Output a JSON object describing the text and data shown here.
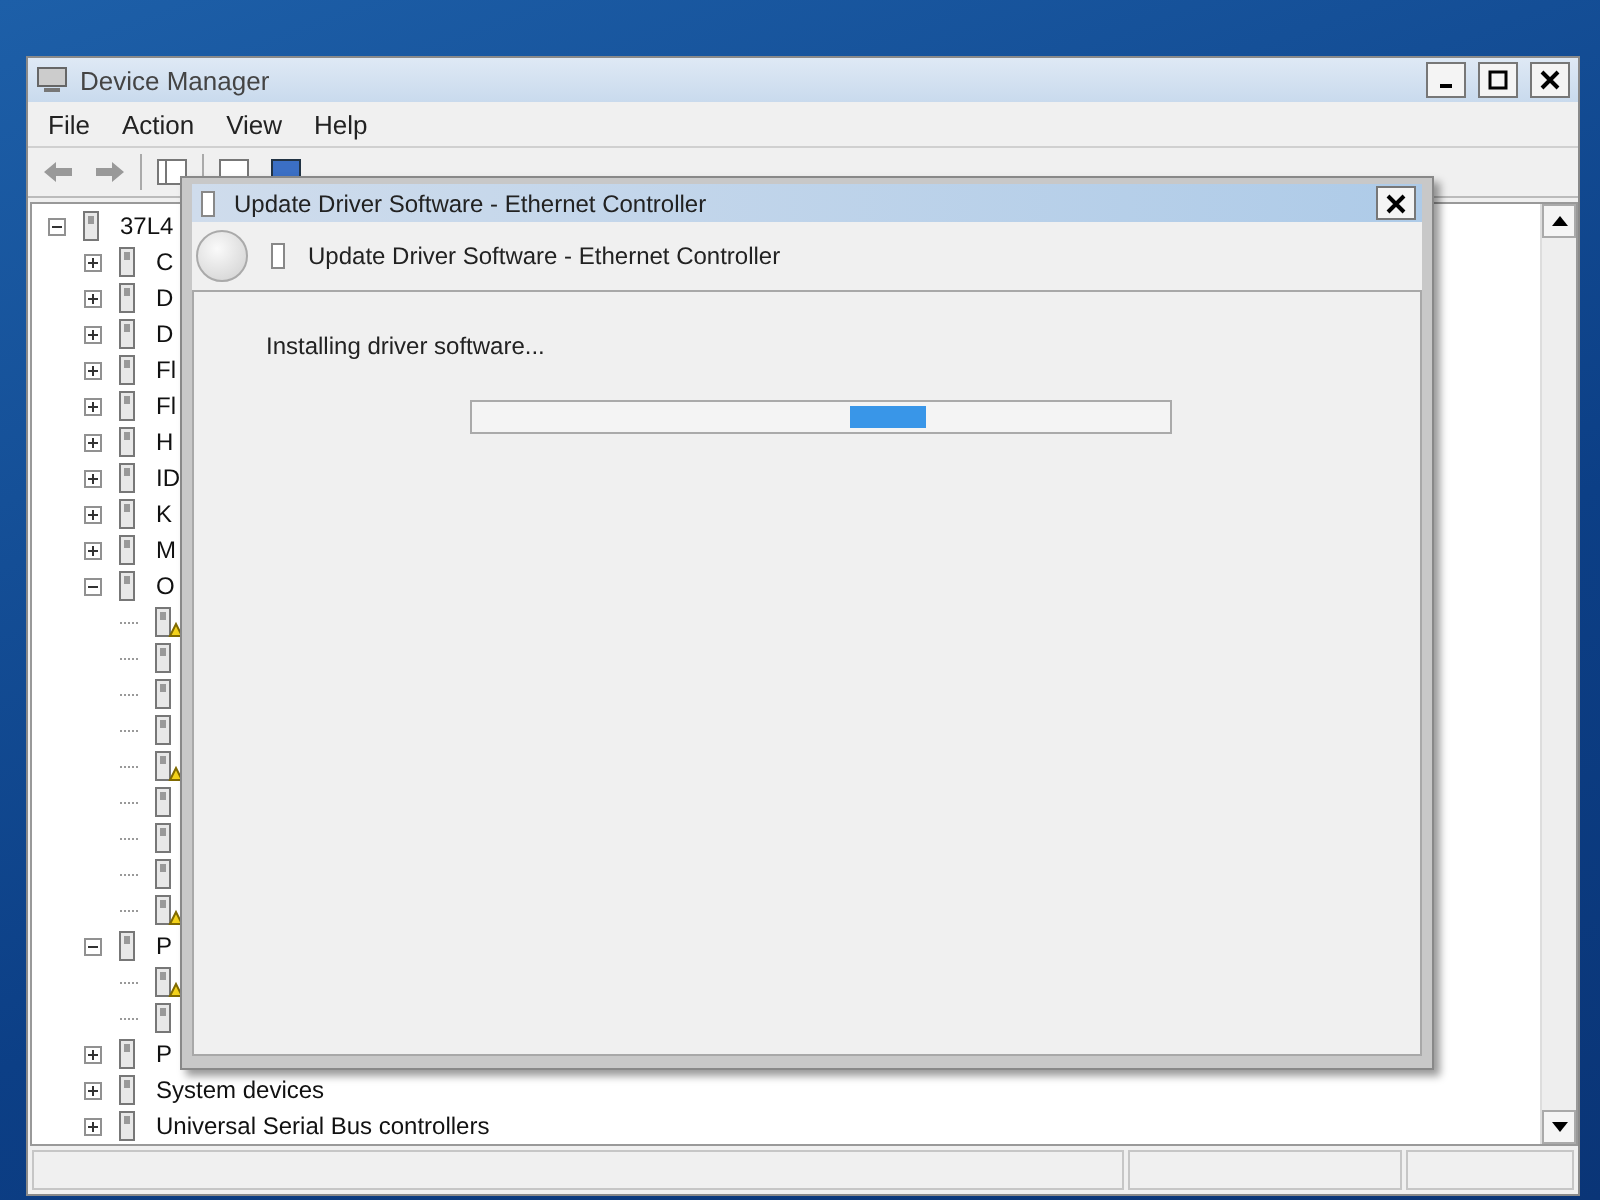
{
  "window": {
    "title": "Device Manager"
  },
  "menu": [
    "File",
    "Action",
    "View",
    "Help"
  ],
  "tree": [
    {
      "label": "37L4",
      "expanded": true,
      "children": [
        {
          "label": "C",
          "expanded": false
        },
        {
          "label": "D",
          "expanded": false
        },
        {
          "label": "D",
          "expanded": false
        },
        {
          "label": "Fl",
          "expanded": false
        },
        {
          "label": "Fl",
          "expanded": false
        },
        {
          "label": "H",
          "expanded": false
        },
        {
          "label": "ID",
          "expanded": false
        },
        {
          "label": "K",
          "expanded": false
        },
        {
          "label": "M",
          "expanded": false
        },
        {
          "label": "O",
          "expanded": true,
          "children": [
            {
              "warning": true
            },
            {
              "warning": false
            },
            {
              "warning": false
            },
            {
              "warning": false
            },
            {
              "warning": true
            },
            {
              "warning": false
            },
            {
              "warning": false
            },
            {
              "warning": false
            },
            {
              "warning": true
            }
          ]
        },
        {
          "label": "P",
          "expanded": true,
          "children": [
            {
              "warning": true
            },
            {
              "warning": false
            }
          ]
        },
        {
          "label": "P",
          "expanded": false
        },
        {
          "label": "System devices",
          "expanded": false
        },
        {
          "label": "Universal Serial Bus controllers",
          "expanded": false
        }
      ]
    }
  ],
  "dialog": {
    "title": "Update Driver Software - Ethernet Controller",
    "header": "Update Driver Software - Ethernet Controller",
    "message": "Installing driver software...",
    "progress": {
      "level": 0.65
    }
  }
}
